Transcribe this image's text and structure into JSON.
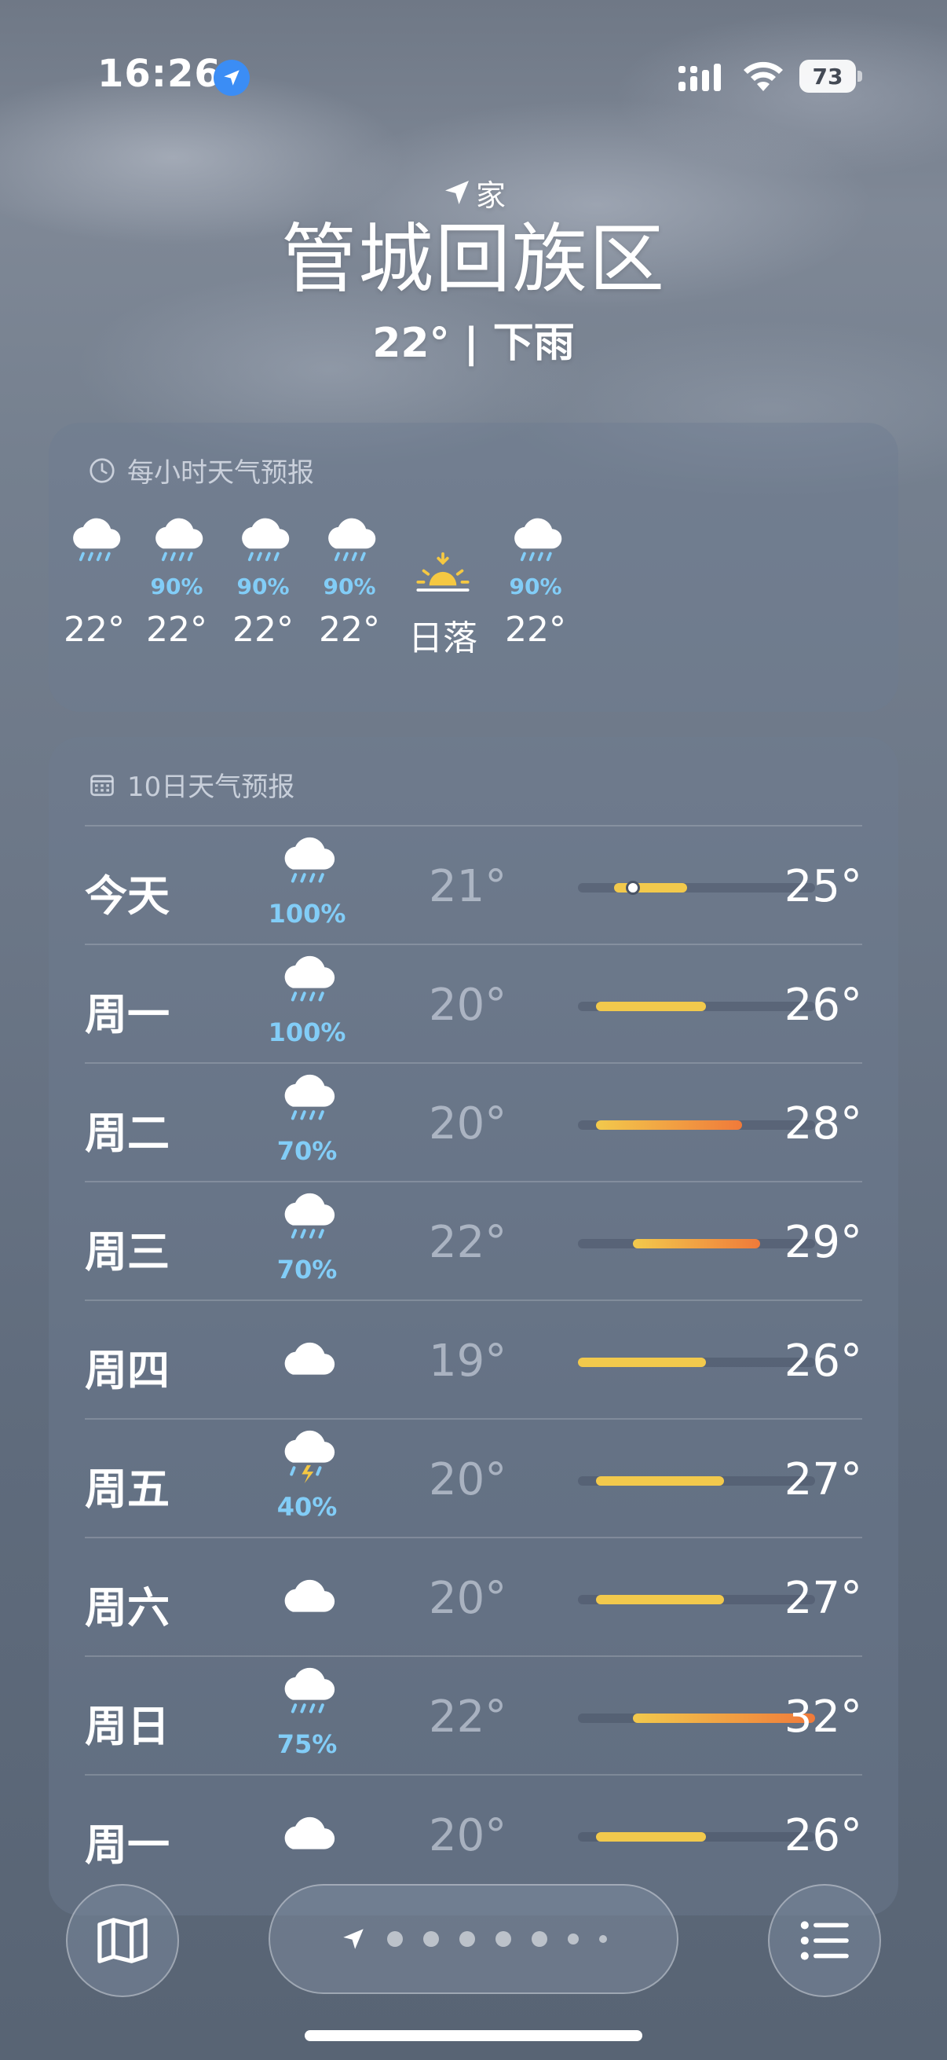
{
  "status_bar": {
    "time": "16:26",
    "battery": "73"
  },
  "header": {
    "home_label": "家",
    "city": "管城回族区",
    "summary": "22° | 下雨"
  },
  "hourly": {
    "title": "每小时天气预报",
    "items": [
      {
        "icon": "rain-cloud-icon",
        "pop": "",
        "temp": "22°"
      },
      {
        "icon": "rain-cloud-icon",
        "pop": "90%",
        "temp": "22°"
      },
      {
        "icon": "rain-cloud-icon",
        "pop": "90%",
        "temp": "22°"
      },
      {
        "icon": "rain-cloud-icon",
        "pop": "90%",
        "temp": "22°"
      },
      {
        "icon": "sunset-icon",
        "pop": "",
        "temp": "日落"
      },
      {
        "icon": "rain-cloud-icon",
        "pop": "90%",
        "temp": "22°"
      }
    ]
  },
  "daily": {
    "title": "10日天气预报",
    "range_min": 19,
    "range_max": 32,
    "current_temp": 22,
    "days": [
      {
        "name": "今天",
        "icon": "rain-cloud-icon",
        "pop": "100%",
        "low": "21°",
        "high": "25°",
        "low_v": 21,
        "high_v": 25
      },
      {
        "name": "周一",
        "icon": "rain-cloud-icon",
        "pop": "100%",
        "low": "20°",
        "high": "26°",
        "low_v": 20,
        "high_v": 26
      },
      {
        "name": "周二",
        "icon": "rain-cloud-icon",
        "pop": "70%",
        "low": "20°",
        "high": "28°",
        "low_v": 20,
        "high_v": 28
      },
      {
        "name": "周三",
        "icon": "rain-cloud-icon",
        "pop": "70%",
        "low": "22°",
        "high": "29°",
        "low_v": 22,
        "high_v": 29
      },
      {
        "name": "周四",
        "icon": "cloud-icon",
        "pop": "",
        "low": "19°",
        "high": "26°",
        "low_v": 19,
        "high_v": 26
      },
      {
        "name": "周五",
        "icon": "thunderstorm-icon",
        "pop": "40%",
        "low": "20°",
        "high": "27°",
        "low_v": 20,
        "high_v": 27
      },
      {
        "name": "周六",
        "icon": "cloud-icon",
        "pop": "",
        "low": "20°",
        "high": "27°",
        "low_v": 20,
        "high_v": 27
      },
      {
        "name": "周日",
        "icon": "rain-cloud-icon",
        "pop": "75%",
        "low": "22°",
        "high": "32°",
        "low_v": 22,
        "high_v": 32
      },
      {
        "name": "周一",
        "icon": "cloud-icon",
        "pop": "",
        "low": "20°",
        "high": "26°",
        "low_v": 20,
        "high_v": 26
      }
    ]
  },
  "bottom_bar": {
    "map_icon": "map-icon",
    "list_icon": "list-icon",
    "page_count": 7,
    "current_page": 0
  },
  "colors": {
    "precip": "#82cdf7",
    "bar_cool": "#f2c94c",
    "bar_warm": "#f07a3a",
    "location_badge": "#3b8df5"
  }
}
